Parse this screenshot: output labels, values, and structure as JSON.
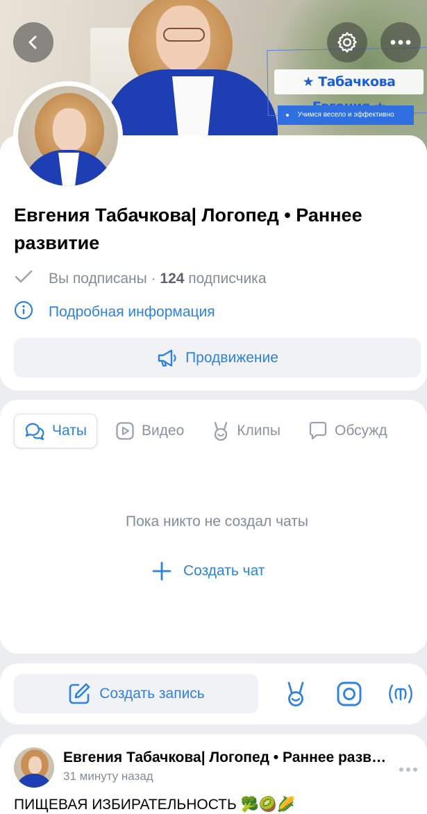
{
  "cover": {
    "banner_name": "★ Табачкова Евгения ★",
    "banner_subtitle": "Учимся весело и эффективно"
  },
  "header": {
    "back_icon": "chevron-left-icon",
    "settings_icon": "gear-icon",
    "more_icon": "more-horizontal-icon"
  },
  "profile": {
    "title": "Евгения Табачкова| Логопед • Раннее развитие",
    "subscribed_label": "Вы подписаны · ",
    "subscriber_count": "124",
    "subscriber_suffix": " подписчика",
    "info_link": "Подробная информация",
    "promo_button": "Продвижение"
  },
  "tabs": [
    {
      "label": "Чаты",
      "icon": "chat-icon",
      "active": true
    },
    {
      "label": "Видео",
      "icon": "video-icon",
      "active": false
    },
    {
      "label": "Клипы",
      "icon": "clips-icon",
      "active": false
    },
    {
      "label": "Обсужд",
      "icon": "discussion-icon",
      "active": false
    }
  ],
  "chats": {
    "empty_text": "Пока никто не создал чаты",
    "create_chat": "Создать чат"
  },
  "compose": {
    "create_post": "Создать запись",
    "icons": [
      "clips-icon",
      "story-icon",
      "live-icon"
    ]
  },
  "post": {
    "author": "Евгения Табачкова| Логопед • Раннее развитие",
    "time": "31 минуту назад",
    "text": "ПИЩЕВАЯ ИЗБИРАТЕЛЬНОСТЬ 🥦🥝🌽"
  },
  "colors": {
    "accent": "#2d81e0",
    "secondary_text": "#818c99",
    "page_bg": "#ebedf0",
    "button_bg": "#f0f2f5"
  }
}
